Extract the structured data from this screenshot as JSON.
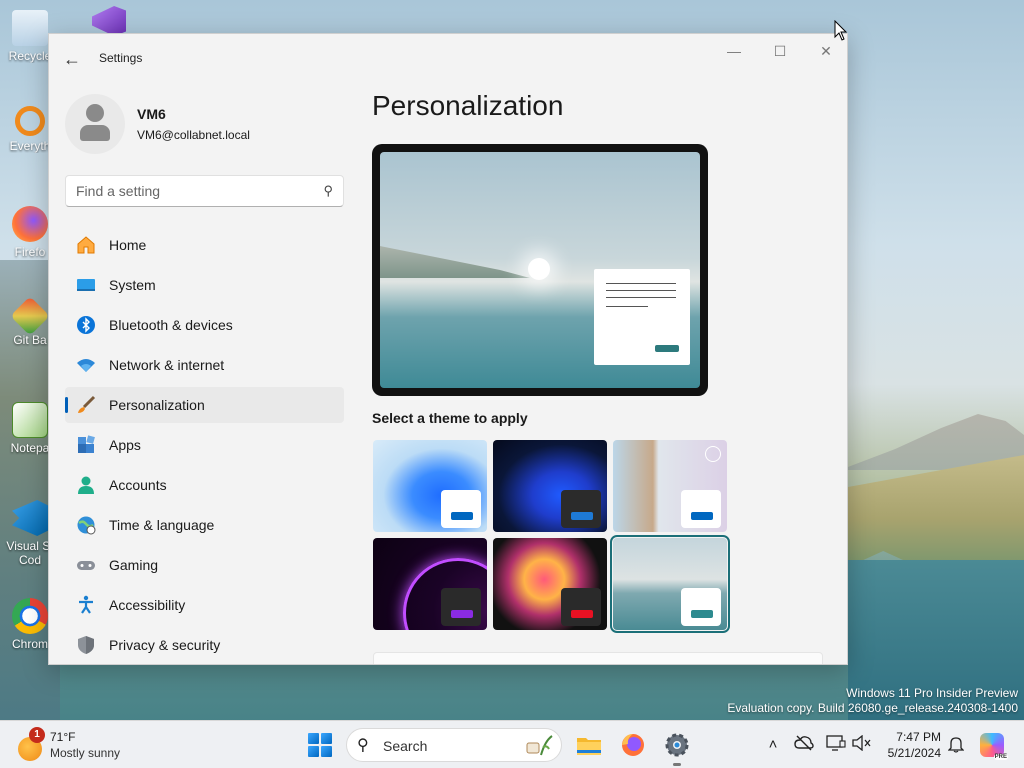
{
  "desktop": {
    "icons": [
      {
        "label": "Recycle",
        "icon": "recycle-bin-icon"
      },
      {
        "label": "Everyth",
        "icon": "everything-search-icon"
      },
      {
        "label": "Firefo",
        "icon": "firefox-icon"
      },
      {
        "label": "Git Ba",
        "icon": "git-bash-icon"
      },
      {
        "label": "Notepa",
        "icon": "notepad-plus-plus-icon"
      },
      {
        "label": "Visual St",
        "label2": "Cod",
        "icon": "vscode-icon"
      },
      {
        "label": "Chrom",
        "icon": "chrome-icon"
      }
    ],
    "watermark": {
      "line1": "Windows 11 Pro Insider Preview",
      "line2": "Evaluation copy. Build 26080.ge_release.240308-1400"
    }
  },
  "window": {
    "title": "Settings",
    "controls": {
      "minimize": "—",
      "maximize": "☐",
      "close": "✕"
    }
  },
  "profile": {
    "name": "VM6",
    "email": "VM6@collabnet.local"
  },
  "search": {
    "placeholder": "Find a setting"
  },
  "nav": {
    "items": [
      {
        "label": "Home",
        "icon": "home-icon",
        "active": false
      },
      {
        "label": "System",
        "icon": "system-icon",
        "active": false
      },
      {
        "label": "Bluetooth & devices",
        "icon": "bluetooth-icon",
        "active": false
      },
      {
        "label": "Network & internet",
        "icon": "wifi-icon",
        "active": false
      },
      {
        "label": "Personalization",
        "icon": "brush-icon",
        "active": true
      },
      {
        "label": "Apps",
        "icon": "apps-icon",
        "active": false
      },
      {
        "label": "Accounts",
        "icon": "account-icon",
        "active": false
      },
      {
        "label": "Time & language",
        "icon": "globe-clock-icon",
        "active": false
      },
      {
        "label": "Gaming",
        "icon": "gamepad-icon",
        "active": false
      },
      {
        "label": "Accessibility",
        "icon": "accessibility-icon",
        "active": false
      },
      {
        "label": "Privacy & security",
        "icon": "shield-icon",
        "active": false
      }
    ]
  },
  "main": {
    "title": "Personalization",
    "themes_label": "Select a theme to apply",
    "themes": [
      {
        "name": "windows-light",
        "selected": false
      },
      {
        "name": "windows-dark",
        "selected": false
      },
      {
        "name": "spotlight",
        "selected": false
      },
      {
        "name": "glow",
        "selected": false
      },
      {
        "name": "captured-motion",
        "selected": false
      },
      {
        "name": "lake",
        "selected": true
      }
    ]
  },
  "taskbar": {
    "weather": {
      "temp": "71°F",
      "condition": "Mostly sunny",
      "badge": "1"
    },
    "search_label": "Search",
    "clock": {
      "time": "7:47 PM",
      "date": "5/21/2024"
    },
    "copilot_badge": "PRE"
  },
  "colors": {
    "accent": "#005fb8",
    "selected_theme_outline": "#1b6f78"
  }
}
